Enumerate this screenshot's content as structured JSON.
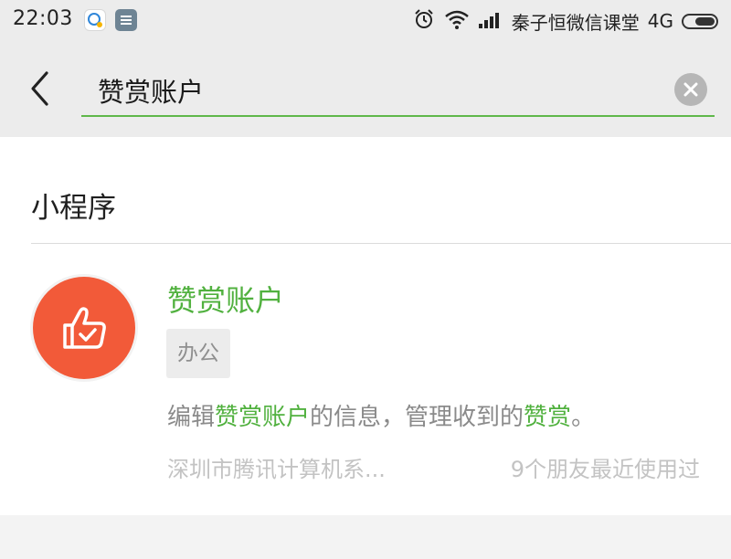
{
  "status_bar": {
    "time": "22:03",
    "carrier": "秦子恒微信课堂",
    "network": "4G",
    "battery_level": 0.65
  },
  "search": {
    "query": "赞赏账户"
  },
  "section": {
    "title": "小程序"
  },
  "result": {
    "name": "赞赏账户",
    "tag": "办公",
    "description": {
      "part1": "编辑",
      "highlight1": "赞赏账户",
      "part2": "的信息，管理收到的",
      "highlight2": "赞赏",
      "part3": "。"
    },
    "developer": "深圳市腾讯计算机系...",
    "usage": "9个朋友最近使用过"
  },
  "colors": {
    "accent_green": "#51b13f",
    "logo_orange": "#f25a39"
  },
  "icons": [
    "alarm-icon",
    "wifi-icon",
    "signal-icon",
    "battery-icon",
    "back-arrow-icon",
    "clear-icon",
    "thumbs-up-check-icon"
  ]
}
